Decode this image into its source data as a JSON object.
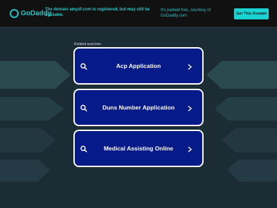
{
  "header": {
    "logo_text": "GoDaddy",
    "notice": "The domain amydf.com is registered, but may still be available.",
    "courtesy": "It's parked free, courtesy of GoDaddy.com",
    "cta_label": "Get This Domain"
  },
  "related": {
    "label": "Related searches",
    "items": [
      {
        "label": "Acp Application"
      },
      {
        "label": "Duns Number Application"
      },
      {
        "label": "Medical Assisting Online"
      }
    ]
  },
  "colors": {
    "accent": "#20c5c5",
    "cta_bg": "#1ad3d3",
    "link_bg": "#061a8a",
    "page_bg": "#1c2c35",
    "banner_bg": "#111111"
  },
  "icons": {
    "logo": "godaddy-logo-icon",
    "search": "search-icon",
    "chevron": "chevron-right-icon"
  }
}
